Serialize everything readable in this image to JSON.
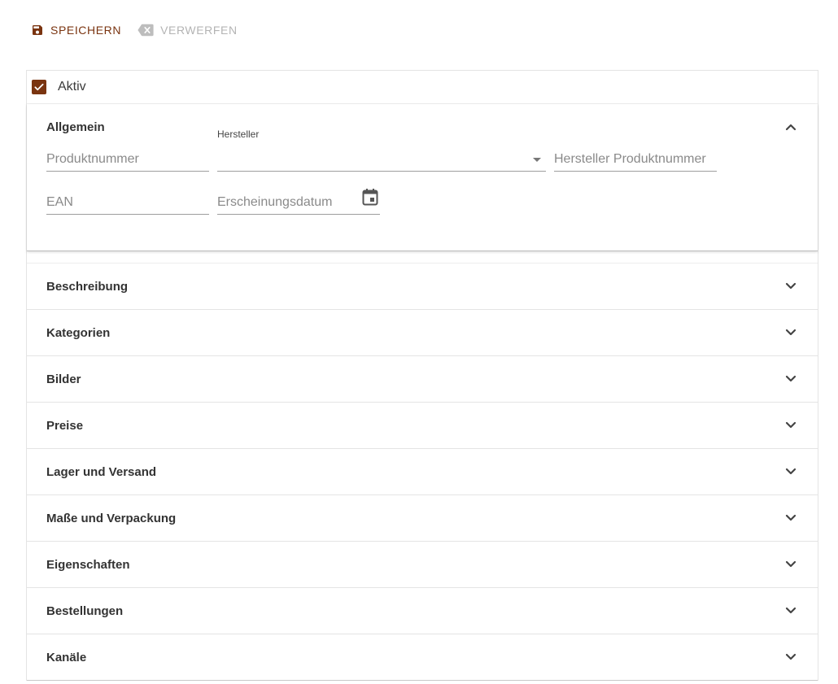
{
  "toolbar": {
    "save_label": "SPEICHERN",
    "discard_label": "VERWERFEN"
  },
  "aktiv": {
    "label": "Aktiv",
    "checked": true
  },
  "allgemein": {
    "title": "Allgemein",
    "fields": {
      "produktnummer": "Produktnummer",
      "hersteller_label": "Hersteller",
      "hersteller_value": "",
      "hersteller_produktnummer": "Hersteller Produktnummer",
      "ean": "EAN",
      "erscheinungsdatum": "Erscheinungsdatum"
    }
  },
  "sections": [
    {
      "label": "Beschreibung"
    },
    {
      "label": "Kategorien"
    },
    {
      "label": "Bilder"
    },
    {
      "label": "Preise"
    },
    {
      "label": "Lager und Versand"
    },
    {
      "label": "Maße und Verpackung"
    },
    {
      "label": "Eigenschaften"
    },
    {
      "label": "Bestellungen"
    },
    {
      "label": "Kanäle"
    }
  ],
  "colors": {
    "accent": "#7a3410",
    "disabled": "#b4b4b4"
  },
  "icons": {
    "save": "floppy-disk-icon",
    "discard": "backspace-x-icon",
    "expand_less": "chevron-up-icon",
    "expand_more": "chevron-down-icon",
    "calendar": "calendar-icon",
    "dropdown": "dropdown-caret-icon"
  }
}
